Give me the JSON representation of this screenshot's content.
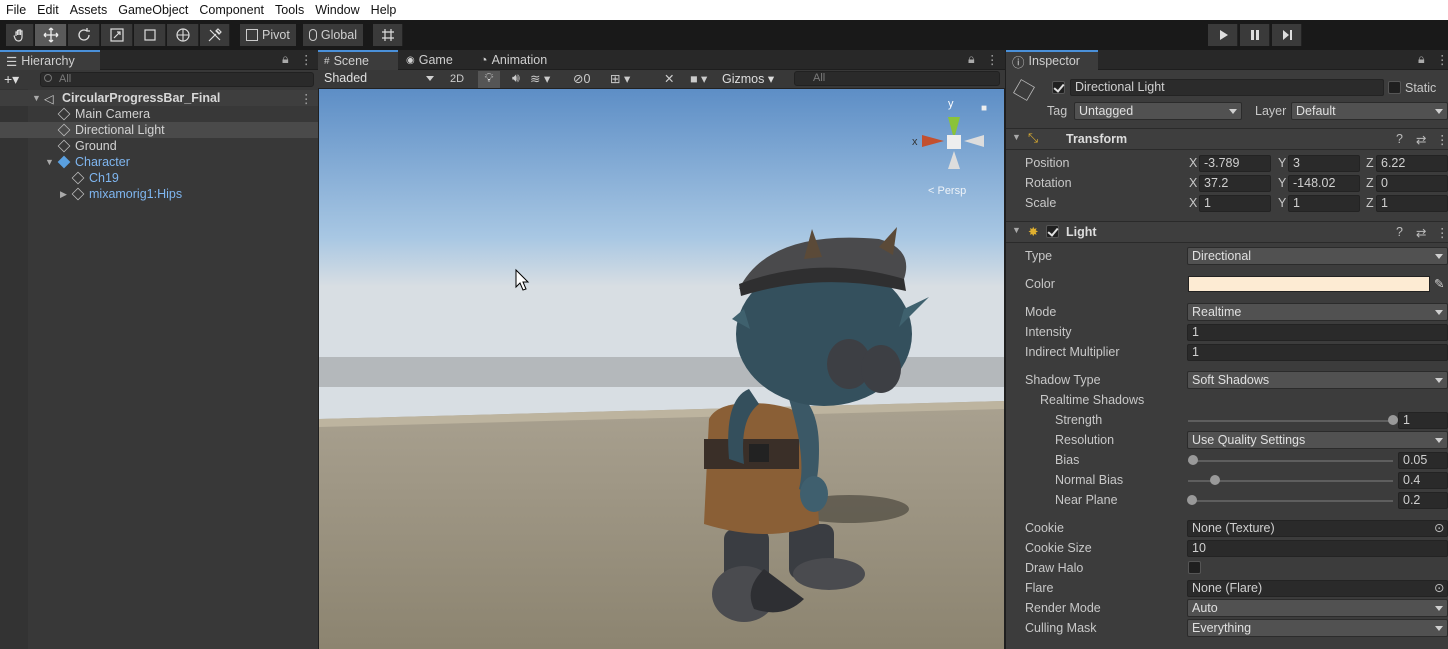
{
  "menu": [
    "File",
    "Edit",
    "Assets",
    "GameObject",
    "Component",
    "Tools",
    "Window",
    "Help"
  ],
  "toolbar": {
    "pivot": "Pivot",
    "global": "Global"
  },
  "hierarchy": {
    "tab": "Hierarchy",
    "search_placeholder": "All",
    "scene_name": "CircularProgressBar_Final",
    "items": [
      {
        "label": "Main Camera"
      },
      {
        "label": "Directional Light"
      },
      {
        "label": "Ground"
      },
      {
        "label": "Character"
      },
      {
        "label": "Ch19"
      },
      {
        "label": "mixamorig1:Hips"
      }
    ]
  },
  "scene": {
    "tabs": [
      "Scene",
      "Game",
      "Animation"
    ],
    "shading": "Shaded",
    "mode_2d": "2D",
    "hidden_count": "0",
    "gizmos": "Gizmos",
    "search_placeholder": "All",
    "gizmo": {
      "y": "y",
      "x": "x",
      "persp": "< Persp"
    }
  },
  "inspector": {
    "tab": "Inspector",
    "object_name": "Directional Light",
    "static": "Static",
    "tag_label": "Tag",
    "tag": "Untagged",
    "layer_label": "Layer",
    "layer": "Default",
    "transform": {
      "title": "Transform",
      "position_label": "Position",
      "rotation_label": "Rotation",
      "scale_label": "Scale",
      "position": {
        "x": "-3.789",
        "y": "3",
        "z": "6.22"
      },
      "rotation": {
        "x": "37.2",
        "y": "-148.02",
        "z": "0"
      },
      "scale": {
        "x": "1",
        "y": "1",
        "z": "1"
      }
    },
    "light": {
      "title": "Light",
      "type_label": "Type",
      "type": "Directional",
      "color_label": "Color",
      "color": "#fdebd3",
      "mode_label": "Mode",
      "mode": "Realtime",
      "intensity_label": "Intensity",
      "intensity": "1",
      "indirect_label": "Indirect Multiplier",
      "indirect": "1",
      "shadow_type_label": "Shadow Type",
      "shadow_type": "Soft Shadows",
      "realtime_shadows_label": "Realtime Shadows",
      "strength_label": "Strength",
      "strength": "1",
      "strength_level": 1.0,
      "resolution_label": "Resolution",
      "resolution": "Use Quality Settings",
      "bias_label": "Bias",
      "bias": "0.05",
      "bias_level": 0.025,
      "normal_bias_label": "Normal Bias",
      "normal_bias": "0.4",
      "normal_bias_level": 0.13,
      "near_plane_label": "Near Plane",
      "near_plane": "0.2",
      "near_plane_level": 0.02,
      "cookie_label": "Cookie",
      "cookie": "None (Texture)",
      "cookie_size_label": "Cookie Size",
      "cookie_size": "10",
      "draw_halo_label": "Draw Halo",
      "flare_label": "Flare",
      "flare": "None (Flare)",
      "render_mode_label": "Render Mode",
      "render_mode": "Auto",
      "culling_mask_label": "Culling Mask",
      "culling_mask": "Everything"
    }
  }
}
